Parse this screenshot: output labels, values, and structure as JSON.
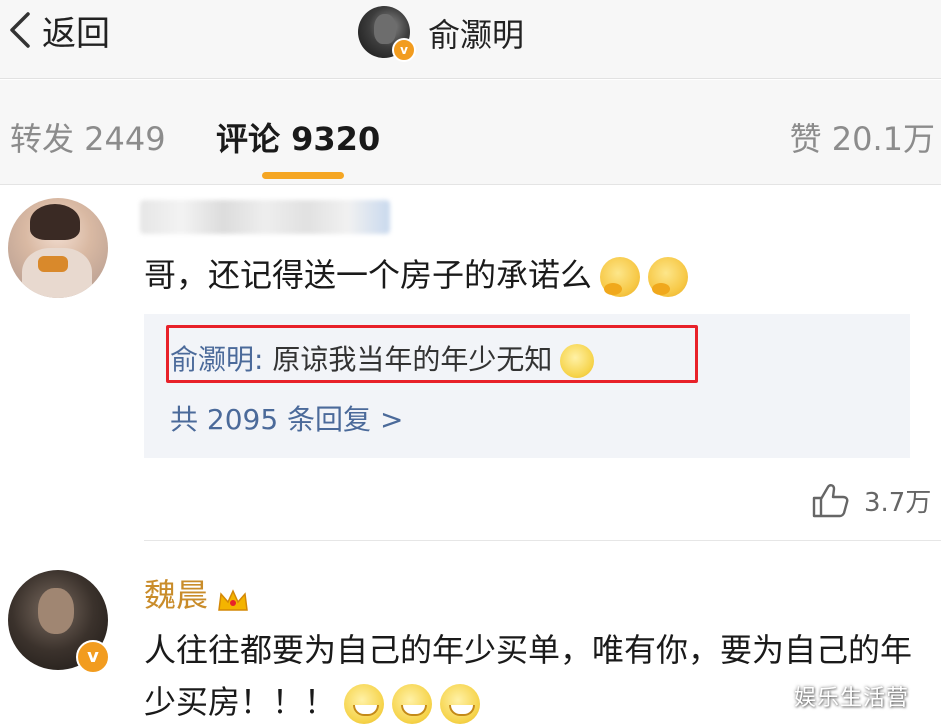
{
  "nav": {
    "back_label": "返回",
    "title": "俞灏明",
    "verified_badge": "v"
  },
  "tabs": {
    "repost": "转发 2449",
    "comment": "评论 9320",
    "like": "赞 20.1万",
    "active": "comment"
  },
  "comments": [
    {
      "author": "",
      "author_blurred": true,
      "text": "哥，还记得送一个房子的承诺么",
      "emojis": [
        "thinking-emoji",
        "thinking-emoji"
      ],
      "reply": {
        "author": "俞灏明",
        "separator": ": ",
        "text": "原谅我当年的年少无知",
        "emoji": "smile-emoji",
        "highlighted": true
      },
      "reply_count_text": "共 2095 条回复 >",
      "likes": "3.7万"
    },
    {
      "author": "魏晨",
      "author_badge": "crown-icon",
      "verified_badge": "v",
      "text": "人往往都要为自己的年少买单，唯有你，要为自己的年少买房！！！",
      "emojis": [
        "grin-emoji",
        "grin-emoji",
        "grin-emoji"
      ]
    }
  ],
  "watermark": "娱乐生活营",
  "colors": {
    "accent_underline": "#f5a623",
    "link_blue": "#4b6a9a",
    "vip_name": "#c98c2a",
    "highlight_box": "#e8212a"
  }
}
